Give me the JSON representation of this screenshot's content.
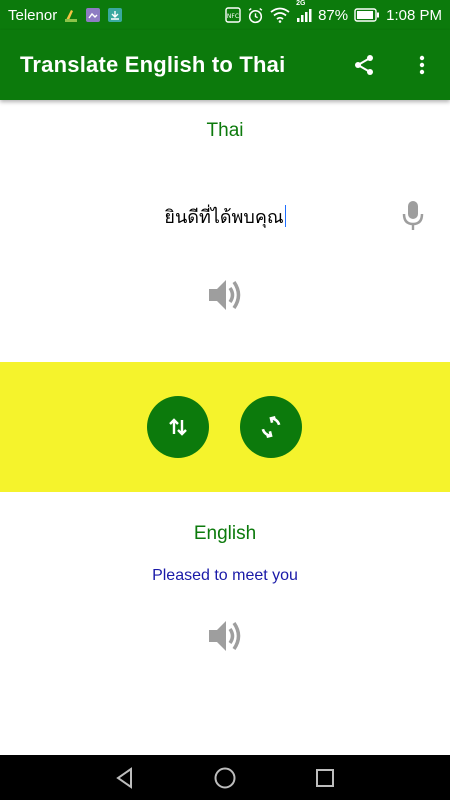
{
  "status_bar": {
    "carrier": "Telenor",
    "network": "2G",
    "battery": "87%",
    "time": "1:08 PM"
  },
  "app_bar": {
    "title": "Translate English to Thai",
    "share_icon": "share-icon",
    "menu_icon": "more-vert-icon"
  },
  "source": {
    "language_label": "Thai",
    "text": "ยินดีที่ได้พบคุณ",
    "mic_icon": "microphone-icon",
    "speaker_icon": "speaker-icon"
  },
  "controls": {
    "swap_icon": "swap-vertical-icon",
    "translate_icon": "refresh-icon",
    "background_color": "#f5f32c",
    "button_color": "#0c7a0c"
  },
  "target": {
    "language_label": "English",
    "text": "Pleased to meet you",
    "speaker_icon": "speaker-icon"
  },
  "colors": {
    "primary": "#0c7a0c",
    "translated_text": "#1a1aa8"
  }
}
